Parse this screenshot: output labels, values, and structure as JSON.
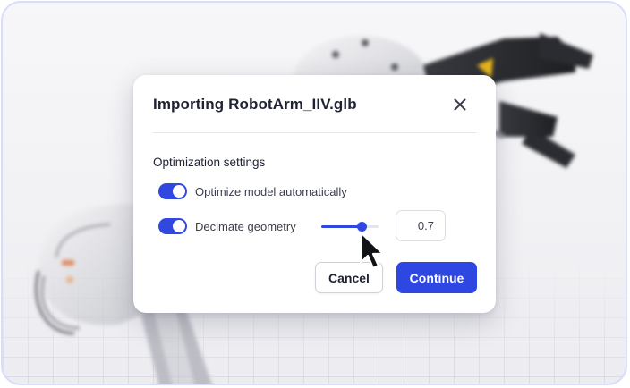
{
  "dialog": {
    "title": "Importing RobotArm_IIV.glb",
    "close_icon": "close-icon",
    "section_title": "Optimization settings",
    "options": [
      {
        "label": "Optimize model automatically",
        "enabled": true
      },
      {
        "label": "Decimate geometry",
        "enabled": true
      }
    ],
    "decimate": {
      "slider_fraction": 0.7,
      "value": "0.7"
    },
    "buttons": {
      "cancel": "Cancel",
      "continue": "Continue"
    }
  },
  "colors": {
    "accent": "#2e47e0",
    "frame_border": "#d9dcfb",
    "text": "#1e2233"
  },
  "icons": [
    "close-icon",
    "pointer-cursor-icon",
    "robot-arm-background"
  ]
}
